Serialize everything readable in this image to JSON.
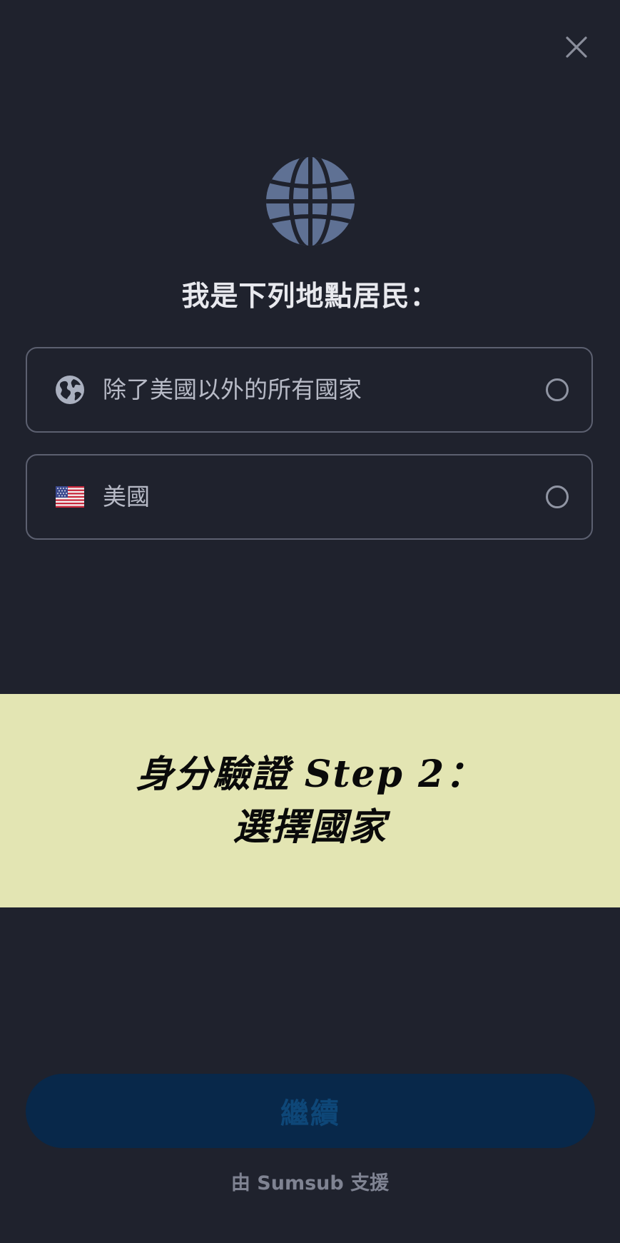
{
  "header": {
    "close_icon": "close-icon"
  },
  "hero": {
    "icon": "globe-icon",
    "icon_color": "#5f7194"
  },
  "title": "我是下列地點居民：",
  "options": [
    {
      "icon": "globe-icon",
      "label": "除了美國以外的所有國家",
      "selected": false
    },
    {
      "icon": "us-flag-icon",
      "label": "美國",
      "selected": false
    }
  ],
  "overlay": {
    "line1": "身分驗證 Step 2：",
    "line2": "選擇國家",
    "background": "#e3e5b3"
  },
  "continue_button": {
    "label": "繼續",
    "background": "#08284a"
  },
  "footer": {
    "text": "由 Sumsub 支援"
  }
}
